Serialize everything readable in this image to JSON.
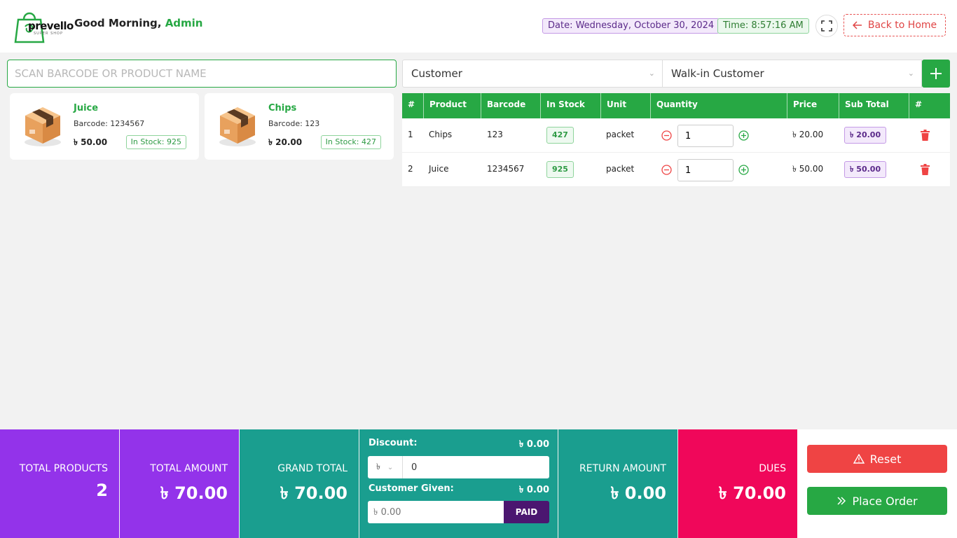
{
  "brand": {
    "name": "prevello",
    "tagline": "SUPER SHOP"
  },
  "header": {
    "greeting": "Good Morning,",
    "user": "Admin",
    "date": "Date: Wednesday, October 30, 2024",
    "time": "Time: 8:57:16 AM",
    "back_label": "Back to Home"
  },
  "search": {
    "placeholder": "SCAN BARCODE OR PRODUCT NAME"
  },
  "products": [
    {
      "name": "Juice",
      "barcode": "Barcode: 1234567",
      "price": "৳ 50.00",
      "stock": "In Stock: 925"
    },
    {
      "name": "Chips",
      "barcode": "Barcode: 123",
      "price": "৳ 20.00",
      "stock": "In Stock: 427"
    }
  ],
  "customer": {
    "type": "Customer",
    "name": "Walk-in Customer"
  },
  "cart": {
    "headers": [
      "#",
      "Product",
      "Barcode",
      "In Stock",
      "Unit",
      "Quantity",
      "Price",
      "Sub Total",
      "#"
    ],
    "rows": [
      {
        "index": "1",
        "product": "Chips",
        "barcode": "123",
        "stock": "427",
        "unit": "packet",
        "quantity": "1",
        "price": "৳ 20.00",
        "subtotal": "৳ 20.00"
      },
      {
        "index": "2",
        "product": "Juice",
        "barcode": "1234567",
        "stock": "925",
        "unit": "packet",
        "quantity": "1",
        "price": "৳ 50.00",
        "subtotal": "৳ 50.00"
      }
    ]
  },
  "summary": {
    "total_products_label": "TOTAL PRODUCTS",
    "total_products": "2",
    "total_amount_label": "TOTAL AMOUNT",
    "total_amount": "৳ 70.00",
    "grand_total_label": "GRAND TOTAL",
    "grand_total": "৳ 70.00",
    "discount_label": "Discount:",
    "discount_amount": "৳ 0.00",
    "discount_currency": "৳",
    "discount_value": "0",
    "given_label": "Customer Given:",
    "given_amount": "৳ 0.00",
    "given_placeholder": "৳ 0.00",
    "paid_label": "PAID",
    "return_label": "RETURN AMOUNT",
    "return_amount": "৳ 0.00",
    "dues_label": "DUES",
    "dues_amount": "৳ 70.00",
    "reset_label": "Reset",
    "order_label": "Place Order"
  },
  "colors": {
    "primary_green": "#27a844",
    "purple": "#9333ea",
    "teal": "#1a9e8f",
    "dues_pink": "#f0075a",
    "reset_red": "#ef4444",
    "paid_purple": "#4b1670"
  }
}
